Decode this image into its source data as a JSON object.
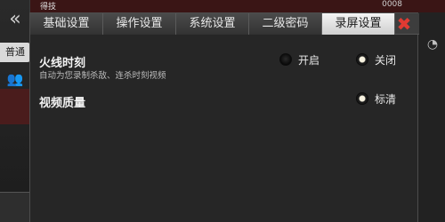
{
  "background": {
    "top_title": "得技",
    "stats": "0008",
    "left_chip": "普通"
  },
  "tabs": [
    {
      "label": "基础设置",
      "active": false
    },
    {
      "label": "操作设置",
      "active": false
    },
    {
      "label": "系统设置",
      "active": false
    },
    {
      "label": "二级密码",
      "active": false
    },
    {
      "label": "录屏设置",
      "active": true
    }
  ],
  "settings": {
    "fire_moment": {
      "title": "火线时刻",
      "description": "自动为您录制杀敌、连杀时刻视频",
      "option_on": "开启",
      "option_off": "关闭",
      "selected": "关闭"
    },
    "video_quality": {
      "title": "视频质量",
      "option": "标清",
      "selected": "标清"
    }
  }
}
